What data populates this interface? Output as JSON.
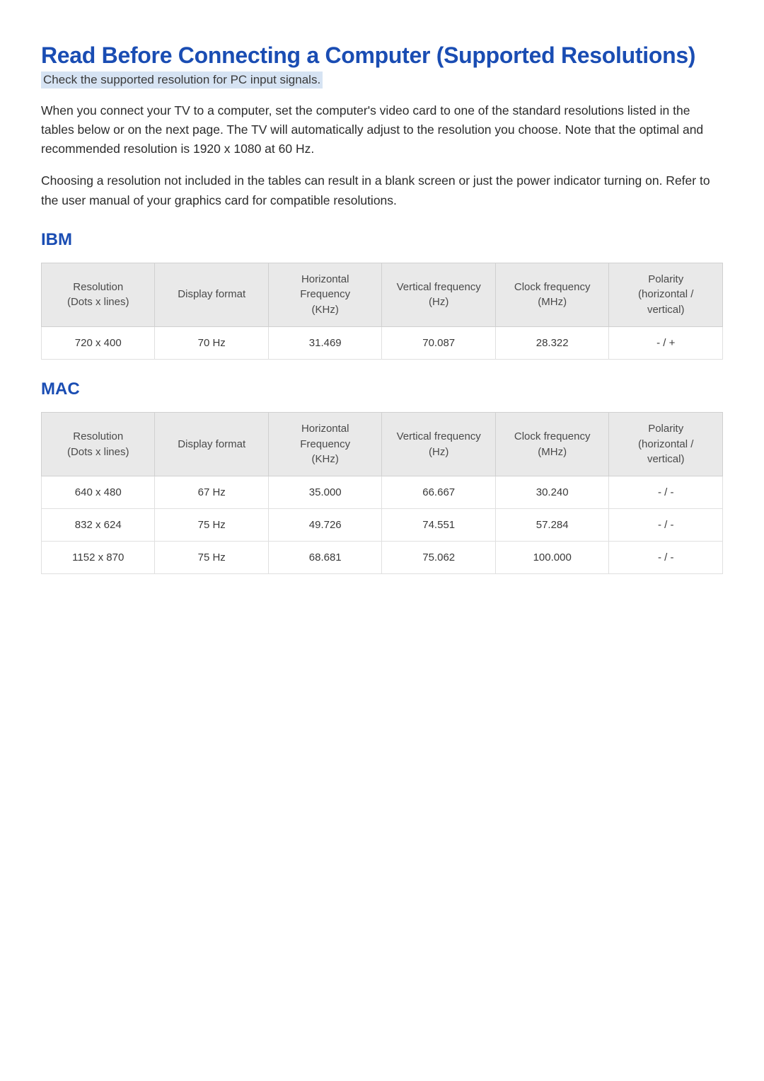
{
  "title": "Read Before Connecting a Computer (Supported Resolutions)",
  "subtitle": "Check the supported resolution for PC input signals.",
  "paragraphs": [
    "When you connect your TV to a computer, set the computer's video card to one of the standard resolutions listed in the tables below or on the next page. The TV will automatically adjust to the resolution you choose. Note that the optimal and recommended resolution is 1920 x 1080 at 60 Hz.",
    "Choosing a resolution not included in the tables can result in a blank screen or just the power indicator turning on. Refer to the user manual of your graphics card for compatible resolutions."
  ],
  "headers": {
    "resolution": "Resolution\n(Dots x lines)",
    "display_format": "Display format",
    "horizontal_freq": "Horizontal\nFrequency\n(KHz)",
    "vertical_freq": "Vertical frequency\n(Hz)",
    "clock_freq": "Clock frequency\n(MHz)",
    "polarity": "Polarity\n(horizontal /\nvertical)"
  },
  "sections": [
    {
      "heading": "IBM",
      "rows": [
        {
          "resolution": "720 x 400",
          "display_format": "70 Hz",
          "horizontal_freq": "31.469",
          "vertical_freq": "70.087",
          "clock_freq": "28.322",
          "polarity": "- / +"
        }
      ]
    },
    {
      "heading": "MAC",
      "rows": [
        {
          "resolution": "640 x 480",
          "display_format": "67 Hz",
          "horizontal_freq": "35.000",
          "vertical_freq": "66.667",
          "clock_freq": "30.240",
          "polarity": "- / -"
        },
        {
          "resolution": "832 x 624",
          "display_format": "75 Hz",
          "horizontal_freq": "49.726",
          "vertical_freq": "74.551",
          "clock_freq": "57.284",
          "polarity": "- / -"
        },
        {
          "resolution": "1152 x 870",
          "display_format": "75 Hz",
          "horizontal_freq": "68.681",
          "vertical_freq": "75.062",
          "clock_freq": "100.000",
          "polarity": "- / -"
        }
      ]
    }
  ]
}
